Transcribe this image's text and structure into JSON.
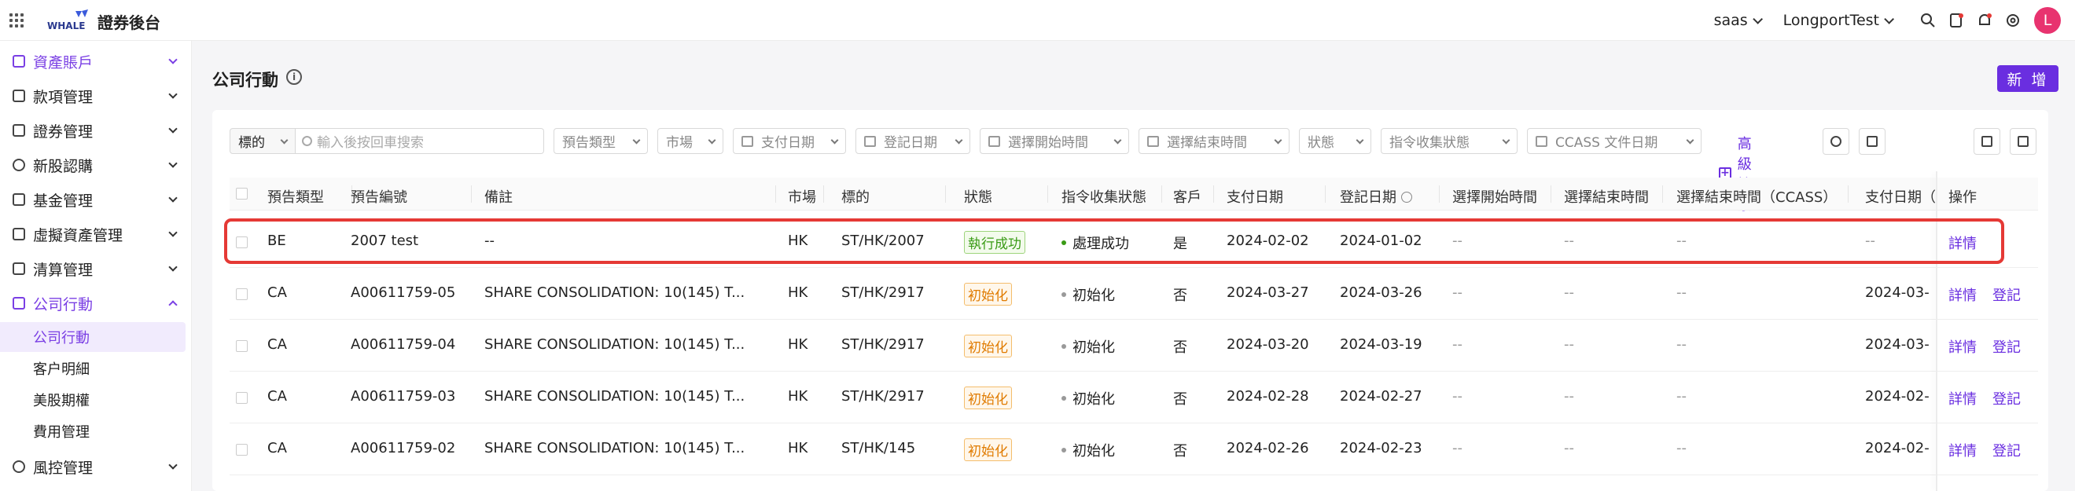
{
  "app": {
    "title": "證券後台",
    "logo_text": "WHALE"
  },
  "topbar": {
    "env": "saas",
    "org": "LongportTest",
    "avatar": "L"
  },
  "sidebar": {
    "items": [
      {
        "label": "資產賬戶",
        "active": true
      },
      {
        "label": "款項管理"
      },
      {
        "label": "證券管理"
      },
      {
        "label": "新股認購"
      },
      {
        "label": "基金管理"
      },
      {
        "label": "虛擬資產管理"
      },
      {
        "label": "清算管理"
      },
      {
        "label": "公司行動",
        "active": true,
        "open": true
      },
      {
        "label": "風控管理"
      }
    ],
    "sub_items": [
      {
        "label": "公司行動",
        "selected": true
      },
      {
        "label": "客户明細"
      },
      {
        "label": "美股期權"
      },
      {
        "label": "費用管理"
      }
    ]
  },
  "page": {
    "title": "公司行動",
    "new_button": "新 增"
  },
  "filters": {
    "target_select": "標的",
    "search_placeholder": "輸入後按回車搜索",
    "type": "預告類型",
    "market": "市場",
    "pay_date": "支付日期",
    "record_date": "登記日期",
    "start_time": "選擇開始時間",
    "end_time": "選擇結束時間",
    "status": "狀態",
    "collect_status": "指令收集狀態",
    "ccass_date": "CCASS 文件日期",
    "advanced": "高級搜索"
  },
  "table": {
    "columns": [
      "預告類型",
      "預告編號",
      "備註",
      "市場",
      "標的",
      "狀態",
      "指令收集狀態",
      "客戶",
      "支付日期",
      "登記日期",
      "選擇開始時間",
      "選擇結束時間",
      "選擇結束時間（CCASS）",
      "支付日期（",
      "操作"
    ],
    "rows": [
      {
        "type": "BE",
        "code": "2007 test",
        "remark": "--",
        "market": "HK",
        "symbol": "ST/HK/2007",
        "status": "執行成功",
        "collect": "處理成功",
        "client": "是",
        "pay_date": "2024-02-02",
        "record_date": "2024-01-02",
        "start": "--",
        "end": "--",
        "end_ccass": "--",
        "pay2": "--",
        "actions": [
          "詳情"
        ]
      },
      {
        "type": "CA",
        "code": "A00611759-05",
        "remark": "SHARE CONSOLIDATION: 10(145) T...",
        "market": "HK",
        "symbol": "ST/HK/2917",
        "status": "初始化",
        "collect": "初始化",
        "client": "否",
        "pay_date": "2024-03-27",
        "record_date": "2024-03-26",
        "start": "--",
        "end": "--",
        "end_ccass": "--",
        "pay2": "2024-03-",
        "actions": [
          "詳情",
          "登記"
        ]
      },
      {
        "type": "CA",
        "code": "A00611759-04",
        "remark": "SHARE CONSOLIDATION: 10(145) T...",
        "market": "HK",
        "symbol": "ST/HK/2917",
        "status": "初始化",
        "collect": "初始化",
        "client": "否",
        "pay_date": "2024-03-20",
        "record_date": "2024-03-19",
        "start": "--",
        "end": "--",
        "end_ccass": "--",
        "pay2": "2024-03-",
        "actions": [
          "詳情",
          "登記"
        ]
      },
      {
        "type": "CA",
        "code": "A00611759-03",
        "remark": "SHARE CONSOLIDATION: 10(145) T...",
        "market": "HK",
        "symbol": "ST/HK/2917",
        "status": "初始化",
        "collect": "初始化",
        "client": "否",
        "pay_date": "2024-02-28",
        "record_date": "2024-02-27",
        "start": "--",
        "end": "--",
        "end_ccass": "--",
        "pay2": "2024-02-",
        "actions": [
          "詳情",
          "登記"
        ]
      },
      {
        "type": "CA",
        "code": "A00611759-02",
        "remark": "SHARE CONSOLIDATION: 10(145) T...",
        "market": "HK",
        "symbol": "ST/HK/145",
        "status": "初始化",
        "collect": "初始化",
        "client": "否",
        "pay_date": "2024-02-26",
        "record_date": "2024-02-23",
        "start": "--",
        "end": "--",
        "end_ccass": "--",
        "pay2": "2024-02-",
        "actions": [
          "詳情",
          "登記"
        ]
      }
    ]
  },
  "colors": {
    "accent": "#6a2ee0",
    "success": "#3a9b16",
    "warning": "#e07b00",
    "highlight": "#e53935"
  }
}
